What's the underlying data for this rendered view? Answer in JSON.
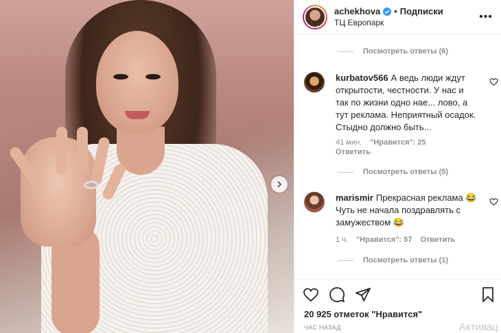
{
  "post": {
    "username": "achekhova",
    "follow_label": "Подписки",
    "location": "ТЦ Европарк",
    "likes_count": "20 925 отметок",
    "likes_link": "\"Нравится\"",
    "time_ago": "ЧАС НАЗАД"
  },
  "comments": {
    "replies_1": "Посмотреть ответы (6)",
    "c1": {
      "user": "kurbatov566",
      "text": "А ведь люди ждут открытости, честности. У нас и так по жизни одно нае... лово, а тут реклама. Неприятный осадок. Стыдно должно быть...",
      "time": "41 мин.",
      "likes": "\"Нравится\": 25",
      "reply": "Ответить"
    },
    "replies_2": "Посмотреть ответы (5)",
    "c2": {
      "user": "marismir",
      "text": "Прекрасная реклама 😂 Чуть не начала поздравлять с замужеством 😂",
      "time": "1 ч.",
      "likes": "\"Нравится\": 57",
      "reply": "Ответить"
    },
    "replies_3": "Посмотреть ответы (1)"
  },
  "overlay": {
    "activate_text": "Активац"
  },
  "colors": {
    "verified": "#3897f0",
    "muted": "#8e8e8e",
    "text": "#262626"
  }
}
